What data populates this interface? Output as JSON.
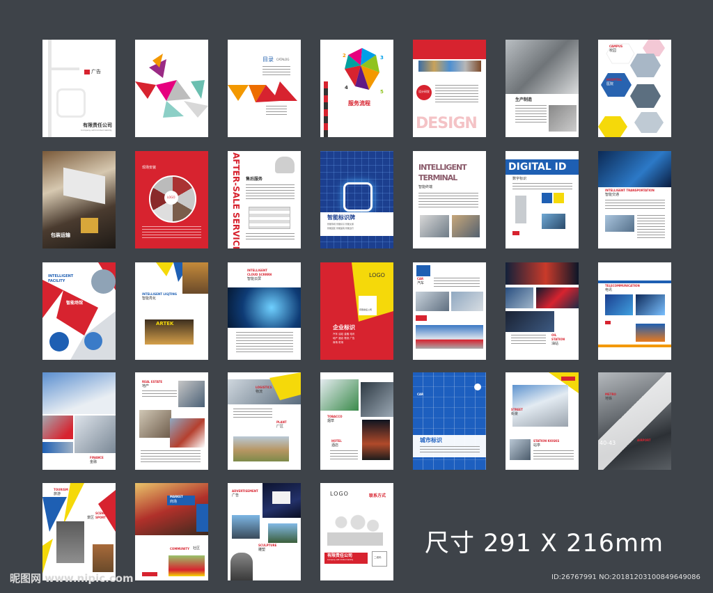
{
  "pages": {
    "p1": {
      "company": "有限责任公司",
      "sub": "Company with limited liability",
      "brand": "广告"
    },
    "p3": {
      "title": "目录",
      "sub": "CATALOG"
    },
    "p4": {
      "title": "服务流程",
      "n1": "2",
      "n2": "3",
      "n3": "4",
      "n4": "5"
    },
    "p5": {
      "badge": "设计研发",
      "design": "DESIGN"
    },
    "p6": {
      "title": "生产制造"
    },
    "p7": {
      "campus_en": "CAMPUS",
      "campus": "校园",
      "hospital_en": "HOSPITAL",
      "hospital": "医院"
    },
    "p8": {
      "title": "包装运输"
    },
    "p9": {
      "title": "现场安装",
      "logo": "LOGO"
    },
    "p10": {
      "vertical": "AFTER-SALE SERVICE",
      "title": "售后服务"
    },
    "p11": {
      "title": "智能标识牌",
      "sub1": "智能导视 智能标识 智能交通",
      "sub2": "智能园区 智能医院 智能出行"
    },
    "p12": {
      "l1": "INTELLIGENT",
      "l2": "TERMINAL",
      "title": "智能终端"
    },
    "p13": {
      "title": "DIGITAL ID",
      "sub": "数字标识"
    },
    "p14": {
      "en": "INTELLIGENT TRANSPORTATION",
      "title": "智能交通"
    },
    "p15": {
      "en1": "INTELLIGENT",
      "en2": "FACILITY",
      "title": "智能场馆"
    },
    "p16": {
      "en": "INTELLIGENT LIGJTING",
      "title": "智能亮化",
      "sign": "ARTEK"
    },
    "p17": {
      "en1": "INTELLIGENT",
      "en2": "CLOUD SCRRRN",
      "title": "智能云屏"
    },
    "p18": {
      "logo": "LOGO",
      "title": "企业标识",
      "sub1": "汽车 油站 金融 电讯",
      "sub2": "地产 酒店 物流 广告",
      "sub3": "商场 机场",
      "card": "有限责任公司"
    },
    "p19": {
      "en": "CAR",
      "title": "汽车"
    },
    "p20": {
      "en1": "OIL",
      "en2": "STATION",
      "title": "油站"
    },
    "p21": {
      "en": "TELECOMMUNICATION",
      "title": "电讯"
    },
    "p22": {
      "en": "FINANCE",
      "title": "金融"
    },
    "p23": {
      "en": "REAL ESTATE",
      "title": "地产"
    },
    "p24": {
      "en1": "LOGISTICS",
      "title1": "物流",
      "en2": "PLANT",
      "title2": "厂区"
    },
    "p25": {
      "en1": "TOBACCO",
      "title1": "烟草",
      "en2": "HOTEL",
      "title2": "酒店"
    },
    "p26": {
      "en": "CAR",
      "title": "城市标识"
    },
    "p27": {
      "en1": "STREET",
      "title1": "街景",
      "en2": "STATION KIOSKS",
      "title2": "站亭"
    },
    "p28": {
      "en1": "METRO",
      "title1": "地铁",
      "en2": "AIRPORT",
      "title2": "机场",
      "gate": "40-43"
    },
    "p29": {
      "en1": "TOURISM",
      "title1": "旅游",
      "en2": "SCENIC",
      "en3": "SPORT",
      "title2": "景区"
    },
    "p30": {
      "en": "MARKET",
      "title": "商场",
      "en2": "COMMUNITY",
      "title2": "社区"
    },
    "p31": {
      "en1": "ADVERTISEMENT",
      "title1": "广告",
      "en2": "SCULPTURE",
      "title2": "雕塑"
    },
    "p32": {
      "logo": "LOGO",
      "contact": "联系方式",
      "company": "有限责任公司",
      "sub": "Company with limited liability",
      "qr": "二维码"
    }
  },
  "footer": {
    "size_label": "尺寸 291 X 216mm",
    "watermark": "昵图网 www.nipic.com",
    "id_text": "ID:26767991 NO:20181203100849649086"
  },
  "colors": {
    "background": "#3e4349",
    "red": "#d7232f",
    "yellow": "#f5d90a",
    "blue": "#1e5fb3"
  }
}
